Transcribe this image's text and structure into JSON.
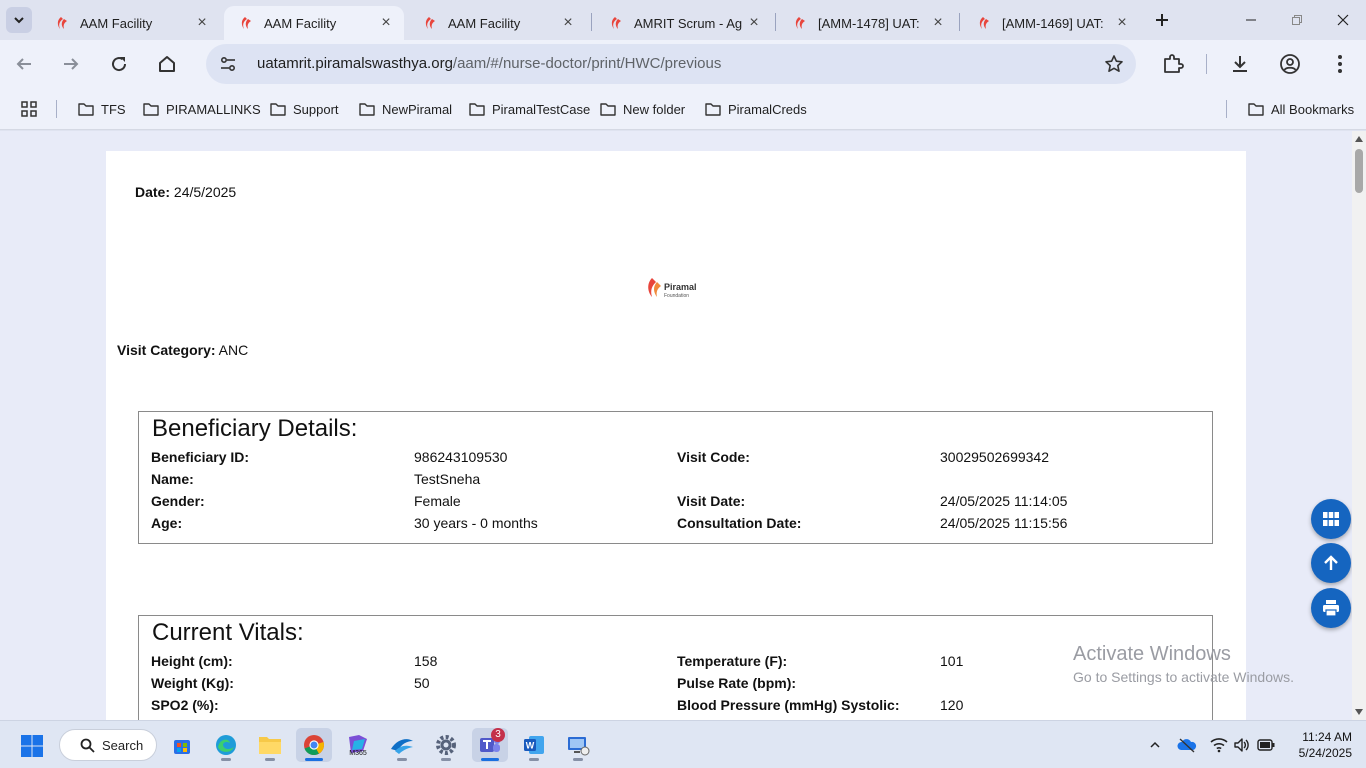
{
  "browser": {
    "tabs": [
      {
        "title": "AAM Facility",
        "active": false
      },
      {
        "title": "AAM Facility",
        "active": true
      },
      {
        "title": "AAM Facility",
        "active": false
      },
      {
        "title": "AMRIT Scrum - Ag",
        "active": false
      },
      {
        "title": "[AMM-1478] UAT:",
        "active": false
      },
      {
        "title": "[AMM-1469] UAT:",
        "active": false
      }
    ],
    "url_host": "uatamrit.piramalswasthya.org",
    "url_path": "/aam/#/nurse-doctor/print/HWC/previous",
    "bookmarks": [
      "TFS",
      "PIRAMALLINKS",
      "Support",
      "NewPiramal",
      "PiramalTestCase",
      "New folder",
      "PiramalCreds"
    ],
    "all_bookmarks": "All Bookmarks",
    "brand_color": "#e8453c",
    "fab_color": "#1565c0"
  },
  "report": {
    "date_label": "Date:",
    "date_value": "24/5/2025",
    "logo_name": "Piramal",
    "logo_sub": "Foundation",
    "visit_category_label": "Visit Category:",
    "visit_category_value": "ANC",
    "beneficiary": {
      "heading": "Beneficiary Details:",
      "rows": [
        [
          "Beneficiary ID:",
          "986243109530",
          "Visit Code:",
          "30029502699342"
        ],
        [
          "Name:",
          "TestSneha",
          "",
          ""
        ],
        [
          "Gender:",
          "Female",
          "Visit Date:",
          "24/05/2025 11:14:05"
        ],
        [
          "Age:",
          "30 years - 0 months",
          "Consultation Date:",
          "24/05/2025 11:15:56"
        ]
      ]
    },
    "vitals": {
      "heading": "Current Vitals:",
      "rows": [
        [
          "Height (cm):",
          "158",
          "Temperature (F):",
          "101"
        ],
        [
          "Weight (Kg):",
          "50",
          "Pulse Rate (bpm):",
          ""
        ],
        [
          "SPO2 (%):",
          "",
          "Blood Pressure (mmHg) Systolic:",
          "120"
        ]
      ]
    }
  },
  "watermark": {
    "line1": "Activate Windows",
    "line2": "Go to Settings to activate Windows."
  },
  "taskbar": {
    "search_label": "Search",
    "teams_badge": "3",
    "time": "11:24 AM",
    "date": "5/24/2025"
  }
}
